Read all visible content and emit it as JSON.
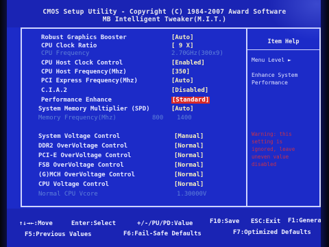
{
  "header": {
    "line1": "CMOS Setup Utility - Copyright (C) 1984-2007 Award Software",
    "line2": "MB Intelligent Tweaker(M.I.T.)"
  },
  "settings": [
    {
      "label": "Robust Graphics Booster",
      "value": "[Auto]",
      "state": "normal"
    },
    {
      "label": "CPU Clock Ratio",
      "value": "[ 9 X]",
      "state": "normal"
    },
    {
      "label": "CPU Frequency",
      "value": "2.70GHz(300x9)",
      "state": "disabled"
    },
    {
      "label": "CPU Host Clock Control",
      "value": "[Enabled]",
      "state": "normal"
    },
    {
      "label": "CPU Host Frequency(Mhz)",
      "value": "[350]",
      "state": "normal"
    },
    {
      "label": "PCI Express Frequency(Mhz)",
      "value": "[Auto]",
      "state": "normal"
    },
    {
      "label": "C.I.A.2",
      "value": "[Disabled]",
      "state": "normal"
    },
    {
      "label": "Performance Enhance",
      "value": "[Standard]",
      "state": "selected"
    },
    {
      "label": "System Memory Multiplier (SPD)",
      "value": "[Auto]",
      "state": "normal"
    },
    {
      "label": "Memory Frequency(Mhz)",
      "value": "800",
      "value2": "1400",
      "state": "disabled"
    },
    {
      "label": "System Voltage Control",
      "value": "[Manual]",
      "state": "normal"
    },
    {
      "label": "DDR2 OverVoltage Control",
      "value": "[Normal]",
      "state": "normal"
    },
    {
      "label": "PCI-E OverVoltage Control",
      "value": "[Normal]",
      "state": "normal"
    },
    {
      "label": "FSB OverVoltage Control",
      "value": "[Normal]",
      "state": "normal"
    },
    {
      "label": "(G)MCH OverVoltage Control",
      "value": "[Normal]",
      "state": "normal"
    },
    {
      "label": "CPU Voltage Control",
      "value": "[Normal]",
      "state": "normal"
    },
    {
      "label": "Normal CPU Vcore",
      "value": "1.30000V",
      "state": "disabled"
    }
  ],
  "help": {
    "title": "Item Help",
    "menu_level": "Menu Level  ►",
    "desc_line1": "Enhance System",
    "desc_line2": "Performance",
    "warning": [
      "Warning: this",
      "setting is",
      "ignored, leave",
      "uneven value",
      "disabled"
    ]
  },
  "footer": {
    "row1": [
      {
        "key": "↑↓→←:Move",
        "name": "move"
      },
      {
        "key": "Enter:Select",
        "name": "select"
      },
      {
        "key": "+/-/PU/PD:Value",
        "name": "value"
      },
      {
        "key": "F10:Save",
        "name": "save"
      },
      {
        "key": "ESC:Exit",
        "name": "exit"
      },
      {
        "key": "F1:General Help",
        "name": "general-help"
      }
    ],
    "row2": [
      {
        "key": "F5:Previous Values",
        "name": "previous-values"
      },
      {
        "key": "F6:Fail-Safe Defaults",
        "name": "fail-safe-defaults"
      },
      {
        "key": "F7:Optimized Defaults",
        "name": "optimized-defaults"
      }
    ]
  },
  "colors": {
    "background": "#1c2bc8",
    "highlight": "#d82a2a",
    "value_text": "#f6efc0",
    "disabled_text": "#5f80d8",
    "warning_text": "#c8324a"
  }
}
